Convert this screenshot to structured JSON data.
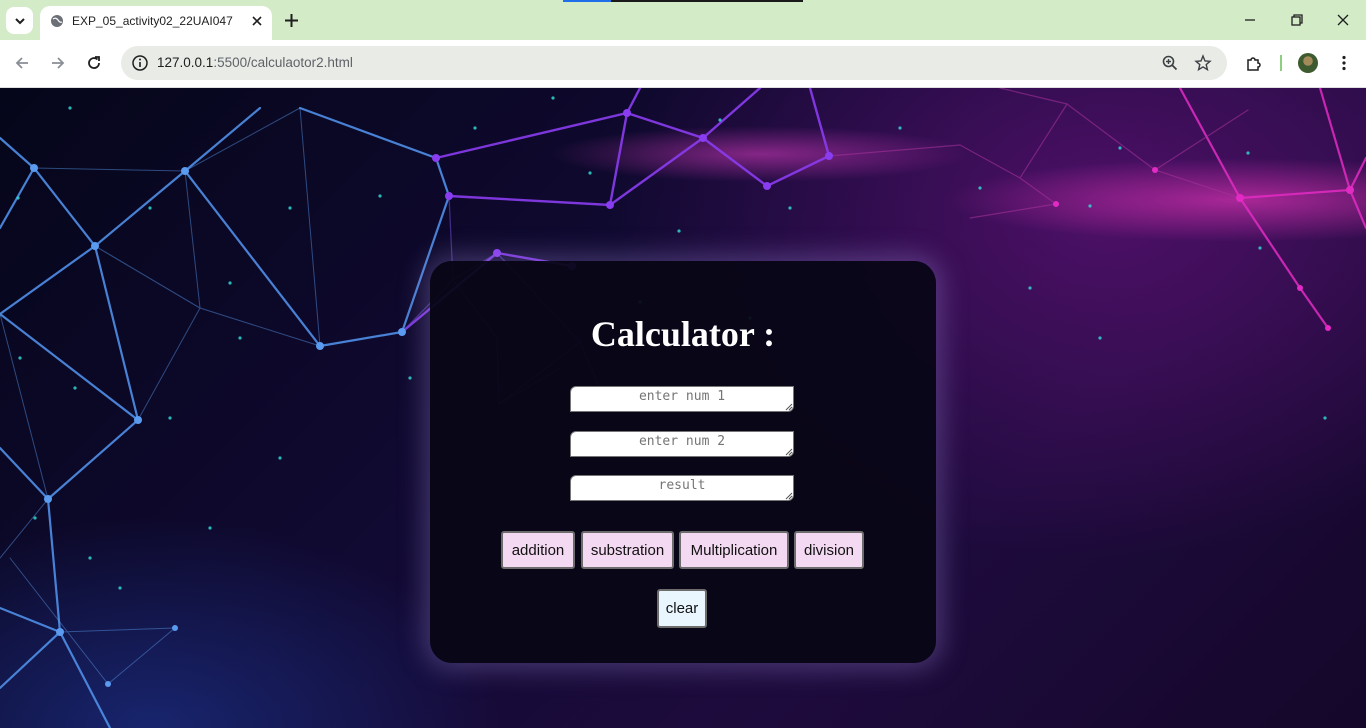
{
  "browser": {
    "tab_title": "EXP_05_activity02_22UAI047",
    "url_host": "127.0.0.1",
    "url_rest": ":5500/calculaotor2.html"
  },
  "calculator": {
    "title": "Calculator :",
    "num1_placeholder": "enter num 1",
    "num2_placeholder": "enter num 2",
    "result_placeholder": "result",
    "buttons": {
      "addition": "addition",
      "subtraction": "substration",
      "multiplication": "Multiplication",
      "division": "division",
      "clear": "clear"
    }
  },
  "colors": {
    "operation_button_bg": "#f4d9f2",
    "clear_button_bg": "#eaf6ff",
    "card_bg": "#080616",
    "tabstrip_bg": "#d3ebc7"
  }
}
